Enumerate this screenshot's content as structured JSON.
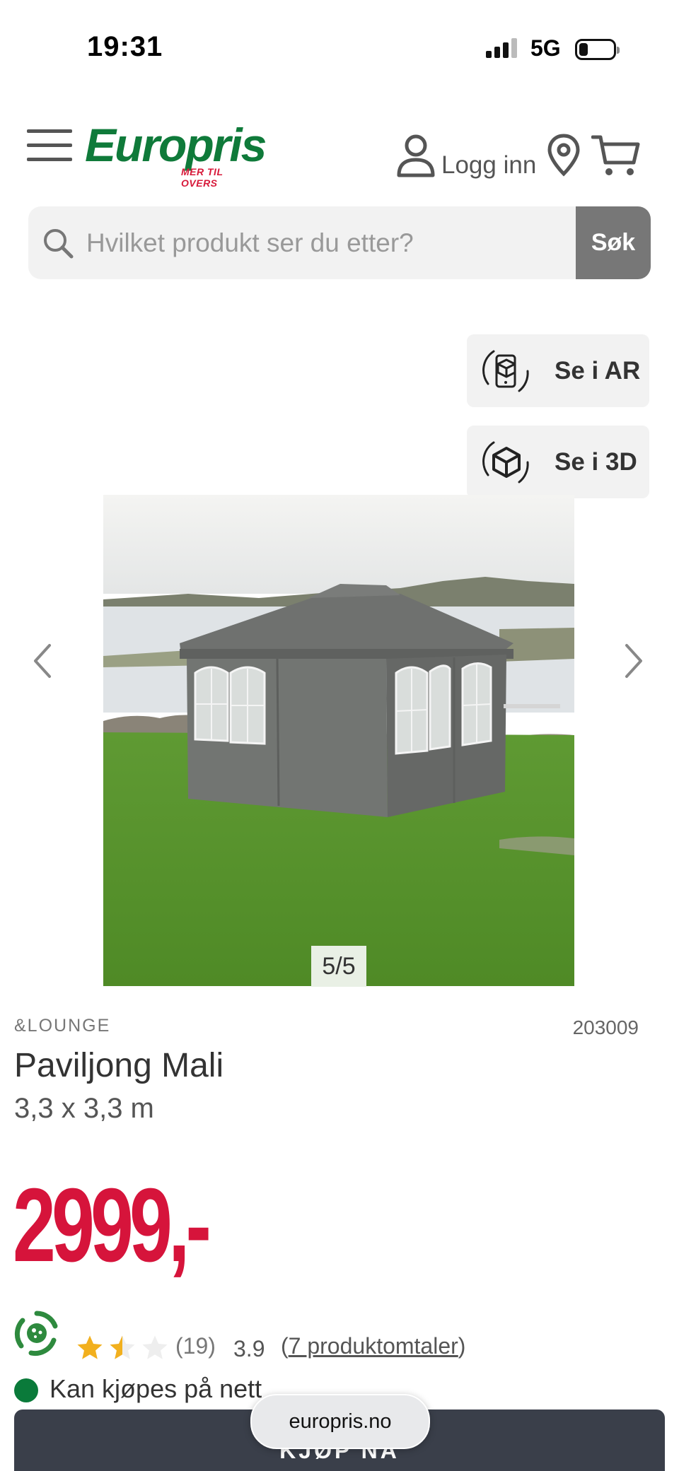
{
  "status_bar": {
    "time": "19:31",
    "network": "5G"
  },
  "header": {
    "logo_text": "Europris",
    "logo_tagline": "MER TIL OVERS",
    "login_label": "Logg inn",
    "colors": {
      "brand_green": "#0f7a3a",
      "brand_red": "#d7193a"
    }
  },
  "search": {
    "placeholder": "Hvilket produkt ser du etter?",
    "button_label": "Søk"
  },
  "viewer": {
    "ar_label": "Se i AR",
    "threed_label": "Se i 3D",
    "image_counter": "5/5"
  },
  "product": {
    "brand": "&LOUNGE",
    "sku": "203009",
    "name": "Paviljong Mali",
    "size": "3,3 x 3,3 m",
    "price": "2999,-",
    "price_color": "#d6143b"
  },
  "rating": {
    "stars_filled": 1.5,
    "stars_total": 5,
    "count": "(19)",
    "value": "3.9",
    "reviews_link_open": "(",
    "reviews_link_text": "7 produktomtaler",
    "reviews_link_close": ")"
  },
  "availability": {
    "text": "Kan kjøpes på nett",
    "status_color": "#0a7a3a"
  },
  "buy": {
    "label": "KJØP NÅ"
  },
  "browser": {
    "url": "europris.no"
  }
}
